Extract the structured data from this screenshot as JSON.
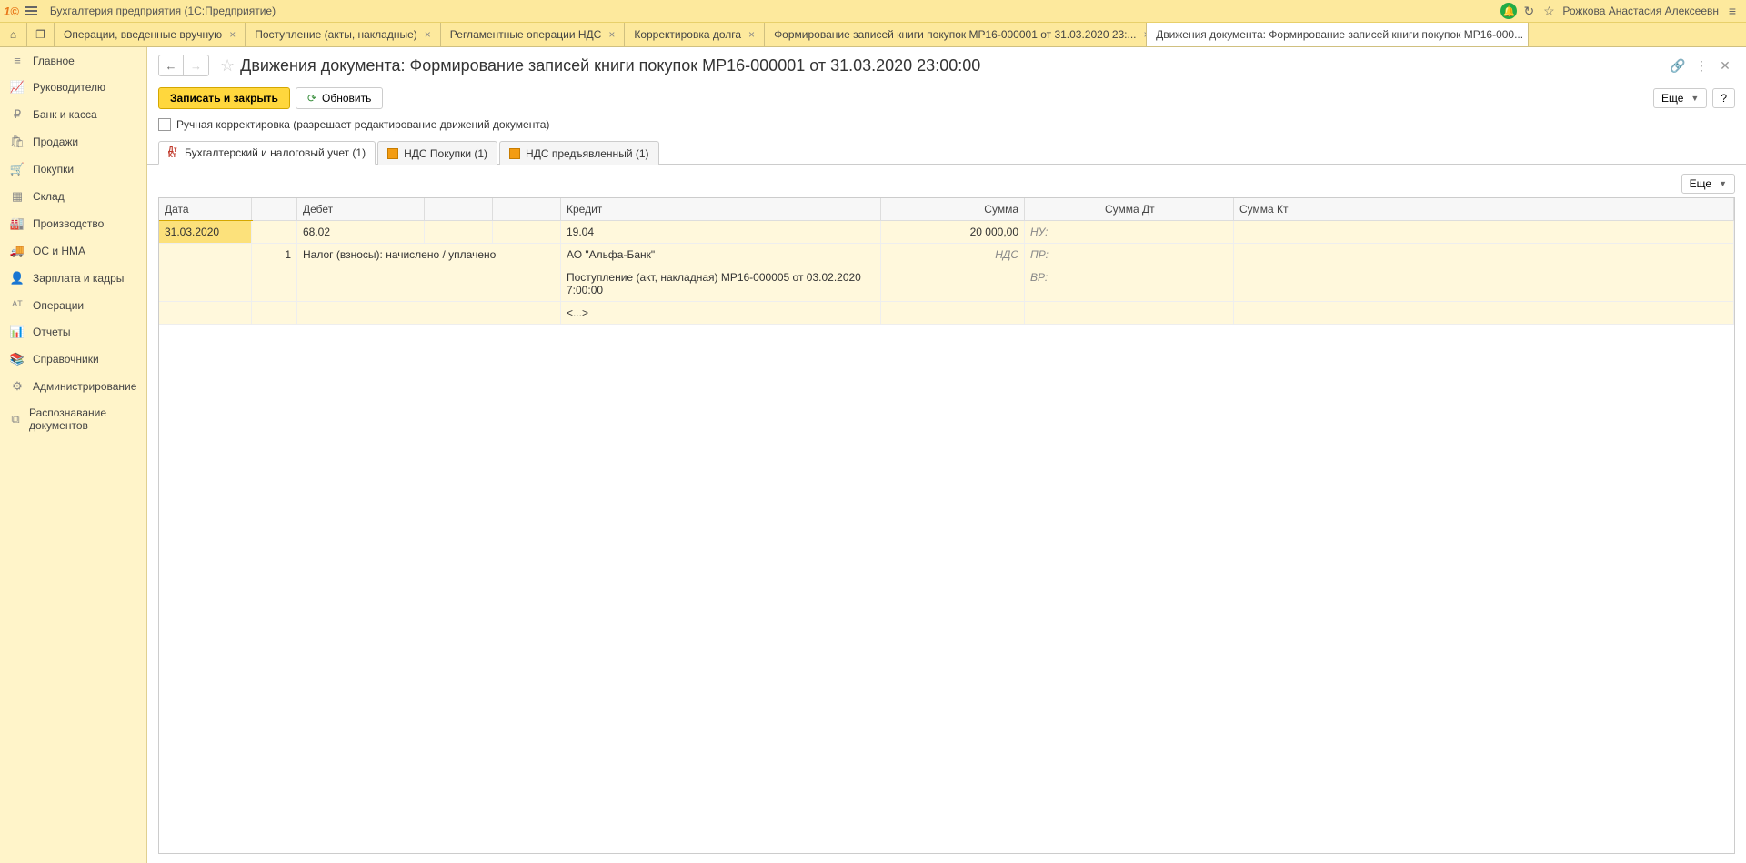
{
  "titlebar": {
    "app": "Бухгалтерия предприятия  (1С:Предприятие)",
    "user": "Рожкова Анастасия Алексеевн"
  },
  "tabs": [
    {
      "label": "Операции, введенные вручную"
    },
    {
      "label": "Поступление (акты, накладные)"
    },
    {
      "label": "Регламентные операции НДС"
    },
    {
      "label": "Корректировка долга"
    },
    {
      "label": "Формирование записей книги покупок МР16-000001 от 31.03.2020 23:..."
    },
    {
      "label": "Движения документа: Формирование записей книги покупок МР16-000...",
      "active": true
    }
  ],
  "sidebar": [
    {
      "icon": "≡",
      "label": "Главное"
    },
    {
      "icon": "📈",
      "label": "Руководителю"
    },
    {
      "icon": "₽",
      "label": "Банк и касса"
    },
    {
      "icon": "🛍",
      "label": "Продажи"
    },
    {
      "icon": "🛒",
      "label": "Покупки"
    },
    {
      "icon": "▦",
      "label": "Склад"
    },
    {
      "icon": "🏭",
      "label": "Производство"
    },
    {
      "icon": "🚚",
      "label": "ОС и НМА"
    },
    {
      "icon": "👤",
      "label": "Зарплата и кадры"
    },
    {
      "icon": "ᴬᵀ",
      "label": "Операции"
    },
    {
      "icon": "📊",
      "label": "Отчеты"
    },
    {
      "icon": "📚",
      "label": "Справочники"
    },
    {
      "icon": "⚙",
      "label": "Администрирование"
    },
    {
      "icon": "⧉",
      "label": "Распознавание документов"
    }
  ],
  "page": {
    "title": "Движения документа: Формирование записей книги покупок МР16-000001 от 31.03.2020 23:00:00",
    "btn_save": "Записать и закрыть",
    "btn_refresh": "Обновить",
    "chk_label": "Ручная корректировка (разрешает редактирование движений документа)",
    "more": "Еще",
    "help": "?"
  },
  "inner_tabs": [
    {
      "label": "Бухгалтерский и налоговый учет (1)",
      "type": "acc",
      "active": true
    },
    {
      "label": "НДС Покупки (1)",
      "type": "reg"
    },
    {
      "label": "НДС предъявленный (1)",
      "type": "reg"
    }
  ],
  "grid": {
    "headers": {
      "date": "Дата",
      "debit": "Дебет",
      "credit": "Кредит",
      "sum": "Сумма",
      "sumdt": "Сумма Дт",
      "sumkt": "Сумма Кт"
    },
    "row1": {
      "date": "31.03.2020",
      "seq": "1",
      "deb_acc": "68.02",
      "deb_sub": "Налог (взносы): начислено / уплачено",
      "cr_acc": "19.04",
      "cr_sub1": "АО \"Альфа-Банк\"",
      "cr_sub2": "Поступление (акт, накладная) МР16-000005 от 03.02.2020 7:00:00",
      "cr_sub3": "<...>",
      "sum": "20 000,00",
      "sum_lab": "НДС",
      "nu": "НУ:",
      "pr": "ПР:",
      "vr": "ВР:"
    }
  }
}
